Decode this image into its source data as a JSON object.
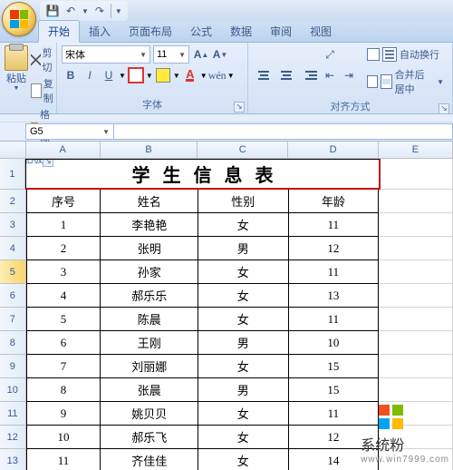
{
  "qat": {
    "save": "save-icon",
    "undo": "undo-icon",
    "redo": "redo-icon"
  },
  "tabs": {
    "home": "开始",
    "insert": "插入",
    "layout": "页面布局",
    "formulas": "公式",
    "data": "数据",
    "review": "审阅",
    "view": "视图"
  },
  "ribbon": {
    "clipboard": {
      "paste": "粘贴",
      "cut": "剪切",
      "copy": "复制",
      "format_painter": "格式刷",
      "label": "剪贴板"
    },
    "font": {
      "name": "宋体",
      "size": "11",
      "grow": "A",
      "shrink": "A",
      "b": "B",
      "i": "I",
      "u": "U",
      "label": "字体",
      "wen": "wén"
    },
    "align": {
      "wrap": "自动换行",
      "merge": "合并后居中",
      "label": "对齐方式"
    }
  },
  "namebox": "G5",
  "columns": [
    "A",
    "B",
    "C",
    "D",
    "E"
  ],
  "title": "学生信息表",
  "headers": {
    "seq": "序号",
    "name": "姓名",
    "gender": "性别",
    "age": "年龄"
  },
  "rows": [
    {
      "n": "1",
      "name": "李艳艳",
      "g": "女",
      "a": "11"
    },
    {
      "n": "2",
      "name": "张明",
      "g": "男",
      "a": "12"
    },
    {
      "n": "3",
      "name": "孙家",
      "g": "女",
      "a": "11"
    },
    {
      "n": "4",
      "name": "郝乐乐",
      "g": "女",
      "a": "13"
    },
    {
      "n": "5",
      "name": "陈晨",
      "g": "女",
      "a": "11"
    },
    {
      "n": "6",
      "name": "王刚",
      "g": "男",
      "a": "10"
    },
    {
      "n": "7",
      "name": "刘丽娜",
      "g": "女",
      "a": "15"
    },
    {
      "n": "8",
      "name": "张晨",
      "g": "男",
      "a": "15"
    },
    {
      "n": "9",
      "name": "姚贝贝",
      "g": "女",
      "a": "11"
    },
    {
      "n": "10",
      "name": "郝乐飞",
      "g": "女",
      "a": "12"
    },
    {
      "n": "11",
      "name": "齐佳佳",
      "g": "女",
      "a": "14"
    }
  ],
  "row_hdrs": [
    "1",
    "2",
    "3",
    "4",
    "5",
    "6",
    "7",
    "8",
    "9",
    "10",
    "11",
    "12",
    "13"
  ],
  "watermark": {
    "line1": "系统粉",
    "line2": "www.win7999.com"
  }
}
